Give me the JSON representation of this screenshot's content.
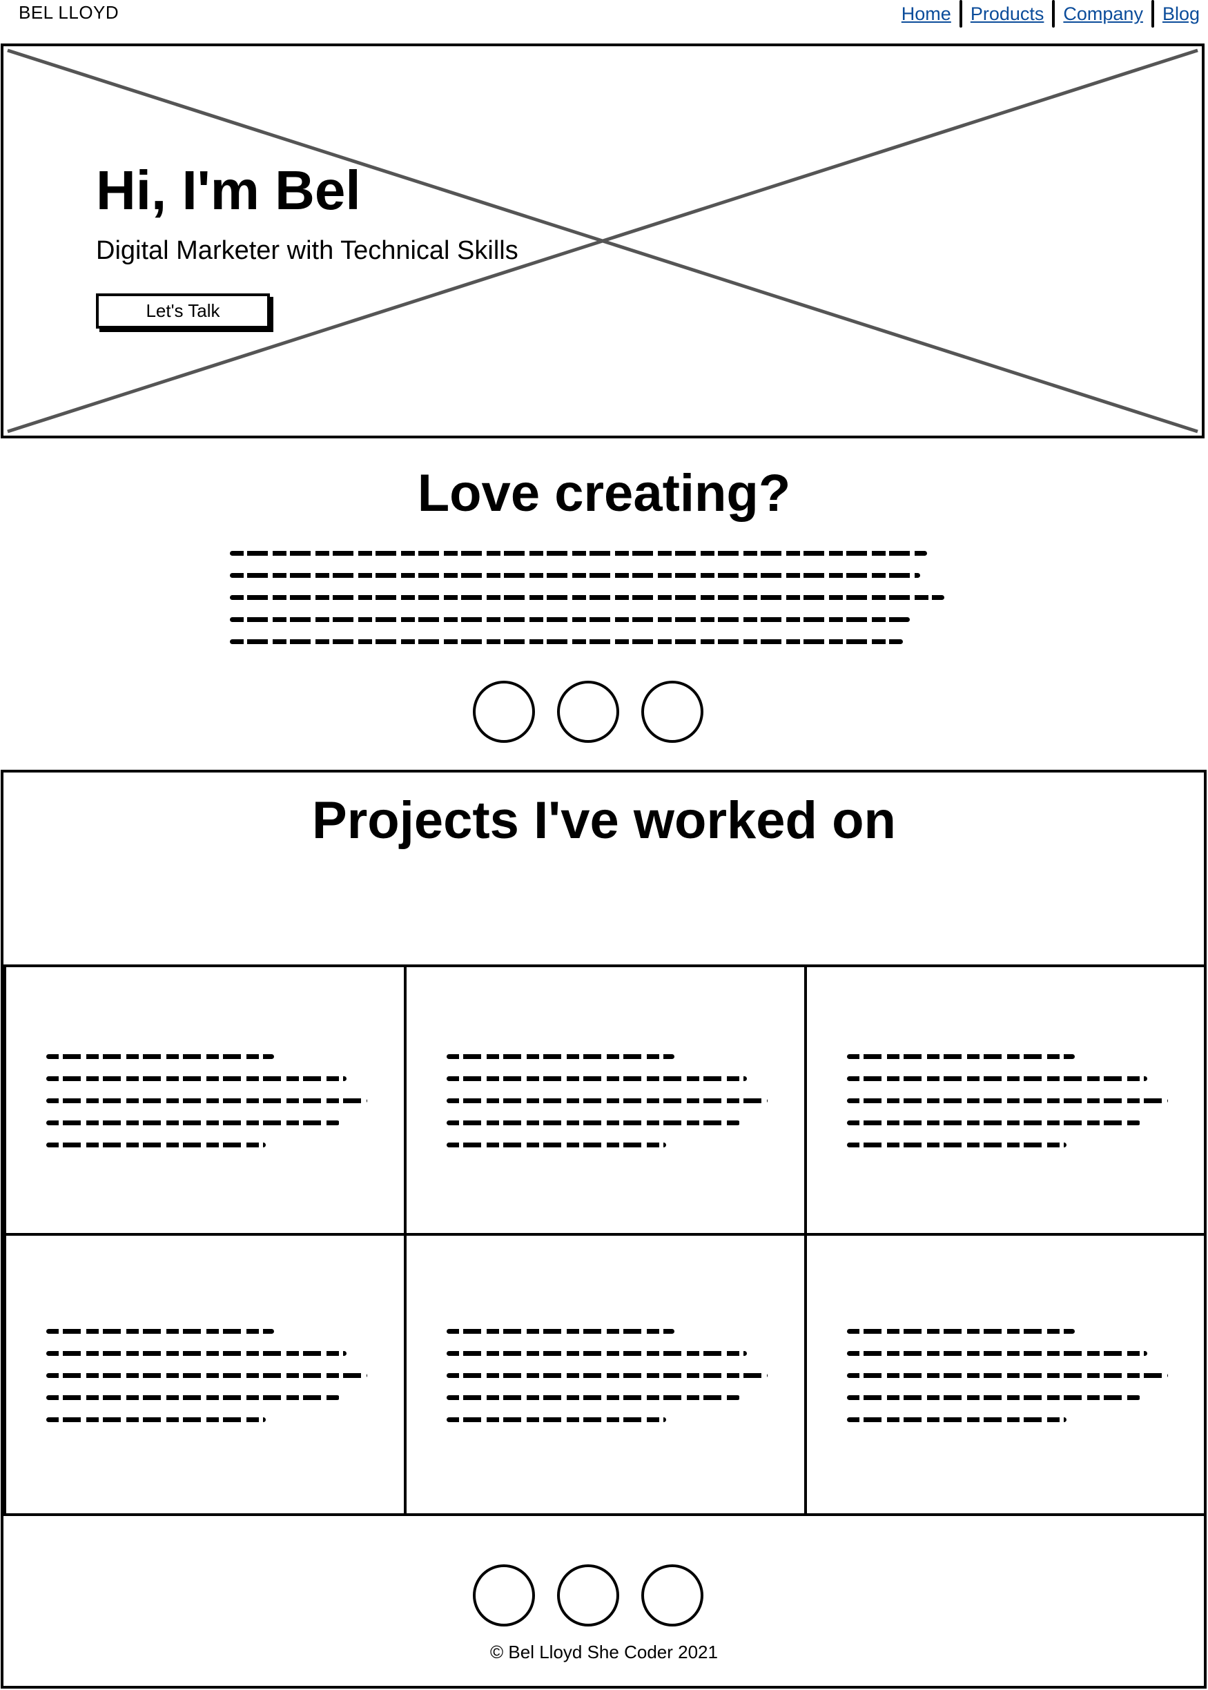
{
  "header": {
    "brand": "BEL LLOYD",
    "nav": [
      {
        "label": "Home"
      },
      {
        "label": "Products"
      },
      {
        "label": "Company"
      },
      {
        "label": "Blog"
      }
    ]
  },
  "hero": {
    "title": "Hi, I'm Bel",
    "subtitle": "Digital Marketer with Technical Skills",
    "cta_label": "Let's Talk",
    "placeholder_icon": "image-placeholder-x"
  },
  "about": {
    "title": "Love creating?",
    "paragraph_icon": "text-scribble",
    "social_icons": [
      "social-icon",
      "social-icon",
      "social-icon"
    ]
  },
  "projects": {
    "title": "Projects I've worked on",
    "cards": [
      {
        "text_icon": "text-scribble"
      },
      {
        "text_icon": "text-scribble"
      },
      {
        "text_icon": "text-scribble"
      },
      {
        "text_icon": "text-scribble"
      },
      {
        "text_icon": "text-scribble"
      },
      {
        "text_icon": "text-scribble"
      }
    ]
  },
  "footer": {
    "social_icons": [
      "social-icon",
      "social-icon",
      "social-icon"
    ],
    "copyright": "© Bel Lloyd She Coder 2021"
  }
}
